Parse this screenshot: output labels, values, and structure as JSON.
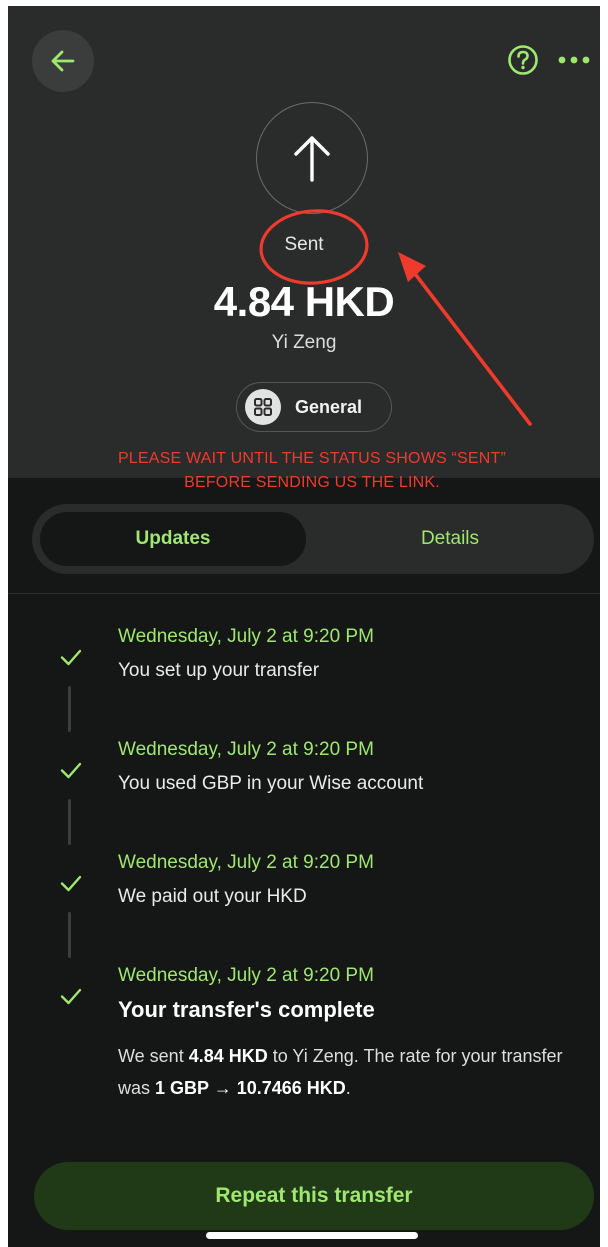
{
  "header": {
    "status_label": "Sent",
    "amount": "4.84 HKD",
    "recipient": "Yi Zeng",
    "category_label": "General"
  },
  "notice": {
    "line1": "PLEASE WAIT UNTIL THE STATUS SHOWS “SENT”",
    "line2": "BEFORE SENDING US THE LINK."
  },
  "tabs": [
    {
      "label": "Updates",
      "active": true
    },
    {
      "label": "Details",
      "active": false
    }
  ],
  "timeline": [
    {
      "date": "Wednesday, July 2 at 9:20 PM",
      "text": "You set up your transfer"
    },
    {
      "date": "Wednesday, July 2 at 9:20 PM",
      "text": "You used GBP in your Wise account"
    },
    {
      "date": "Wednesday, July 2 at 9:20 PM",
      "text": "We paid out your HKD"
    },
    {
      "date": "Wednesday, July 2 at 9:20 PM",
      "text": "Your transfer's complete"
    }
  ],
  "summary": {
    "prefix": "We sent ",
    "amount": "4.84 HKD",
    "middle": " to Yi Zeng. The rate for your transfer was ",
    "rate": "1 GBP → 10.7466 HKD",
    "suffix": "."
  },
  "repeat_button_label": "Repeat this transfer",
  "icons": {
    "back": "arrow-left-icon",
    "help": "question-circle-icon",
    "more": "more-dots-icon",
    "status": "arrow-up-icon",
    "category": "grid-icon",
    "check": "check-icon"
  },
  "colors": {
    "accent": "#9fe870",
    "annotation": "#ee3b2c",
    "header_bg": "#2a2b2b",
    "body_bg": "#151616",
    "button_bg": "#203917"
  }
}
